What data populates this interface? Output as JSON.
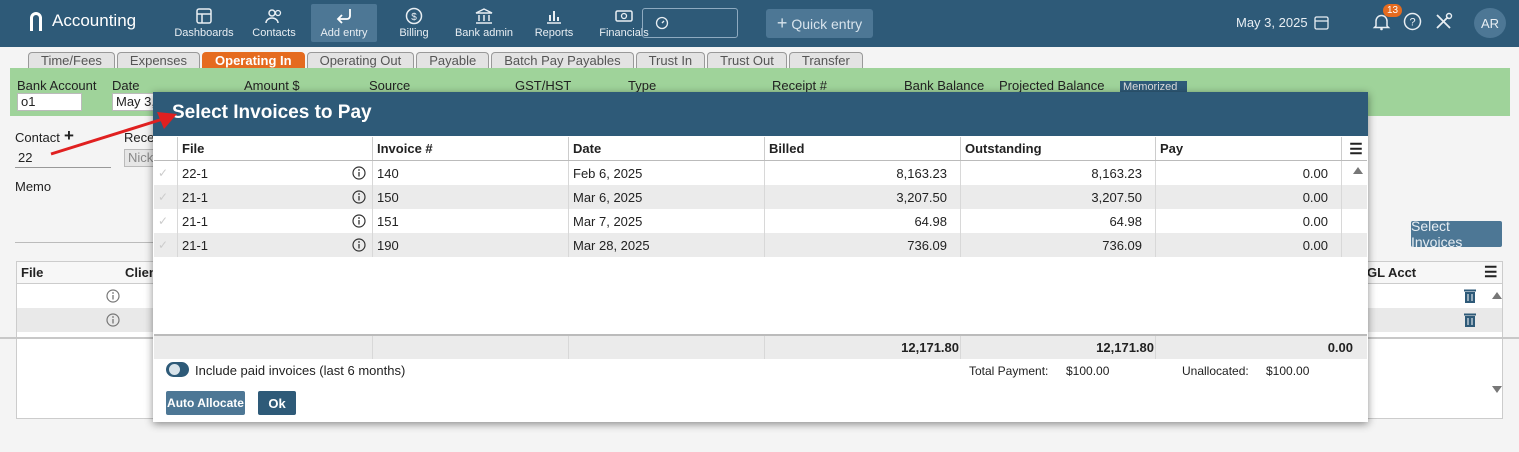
{
  "app": {
    "title": "Accounting"
  },
  "nav": [
    {
      "label": "Dashboards",
      "icon": "dashboard-icon"
    },
    {
      "label": "Contacts",
      "icon": "contacts-icon"
    },
    {
      "label": "Add entry",
      "icon": "add-entry-icon",
      "active": true
    },
    {
      "label": "Billing",
      "icon": "dollar-icon"
    },
    {
      "label": "Bank admin",
      "icon": "bank-icon"
    },
    {
      "label": "Reports",
      "icon": "chart-icon"
    },
    {
      "label": "Financials",
      "icon": "financials-icon"
    }
  ],
  "quick_entry": "Quick entry",
  "top_date": "May 3, 2025",
  "notifications": "13",
  "avatar": "AR",
  "tabs": [
    "Time/Fees",
    "Expenses",
    "Operating In",
    "Operating Out",
    "Payable",
    "Batch Pay Payables",
    "Trust In",
    "Trust Out",
    "Transfer"
  ],
  "active_tab": "Operating In",
  "form": {
    "labels": {
      "bank_account": "Bank Account",
      "date": "Date",
      "amount": "Amount $",
      "source": "Source",
      "gst": "GST/HST",
      "type": "Type",
      "receipt": "Receipt #",
      "bank_balance": "Bank Balance",
      "projected_balance": "Projected Balance",
      "contact": "Contact",
      "receipt_partial": "Rece",
      "memo": "Memo"
    },
    "bank_account_value": "o1",
    "date_value": "May 3,",
    "contact_value": "22",
    "receipt_value_partial": "Nick",
    "memorized": "Memorized",
    "select_invoices": "Select Invoices",
    "table_headers": {
      "file": "File",
      "client": "Clien",
      "gl_acct": "GL Acct"
    }
  },
  "modal": {
    "title": "Select Invoices to Pay",
    "columns": [
      "File",
      "Invoice #",
      "Date",
      "Billed",
      "Outstanding",
      "Pay"
    ],
    "rows": [
      {
        "file": "22-1",
        "invoice": "140",
        "date": "Feb 6, 2025",
        "billed": "8,163.23",
        "outstanding": "8,163.23",
        "pay": "0.00"
      },
      {
        "file": "21-1",
        "invoice": "150",
        "date": "Mar 6, 2025",
        "billed": "3,207.50",
        "outstanding": "3,207.50",
        "pay": "0.00"
      },
      {
        "file": "21-1",
        "invoice": "151",
        "date": "Mar 7, 2025",
        "billed": "64.98",
        "outstanding": "64.98",
        "pay": "0.00"
      },
      {
        "file": "21-1",
        "invoice": "190",
        "date": "Mar 28, 2025",
        "billed": "736.09",
        "outstanding": "736.09",
        "pay": "0.00"
      }
    ],
    "totals": {
      "billed": "12,171.80",
      "outstanding": "12,171.80",
      "pay": "0.00"
    },
    "include_paid_label": "Include paid invoices (last 6 months)",
    "total_payment_label": "Total Payment:",
    "total_payment_value": "$100.00",
    "unallocated_label": "Unallocated:",
    "unallocated_value": "$100.00",
    "auto_allocate": "Auto Allocate",
    "ok": "Ok"
  },
  "colors": {
    "primary": "#2e5a78",
    "accent": "#e56b1f",
    "green_band": "#9fd39a",
    "annotation_arrow": "#e02020"
  }
}
